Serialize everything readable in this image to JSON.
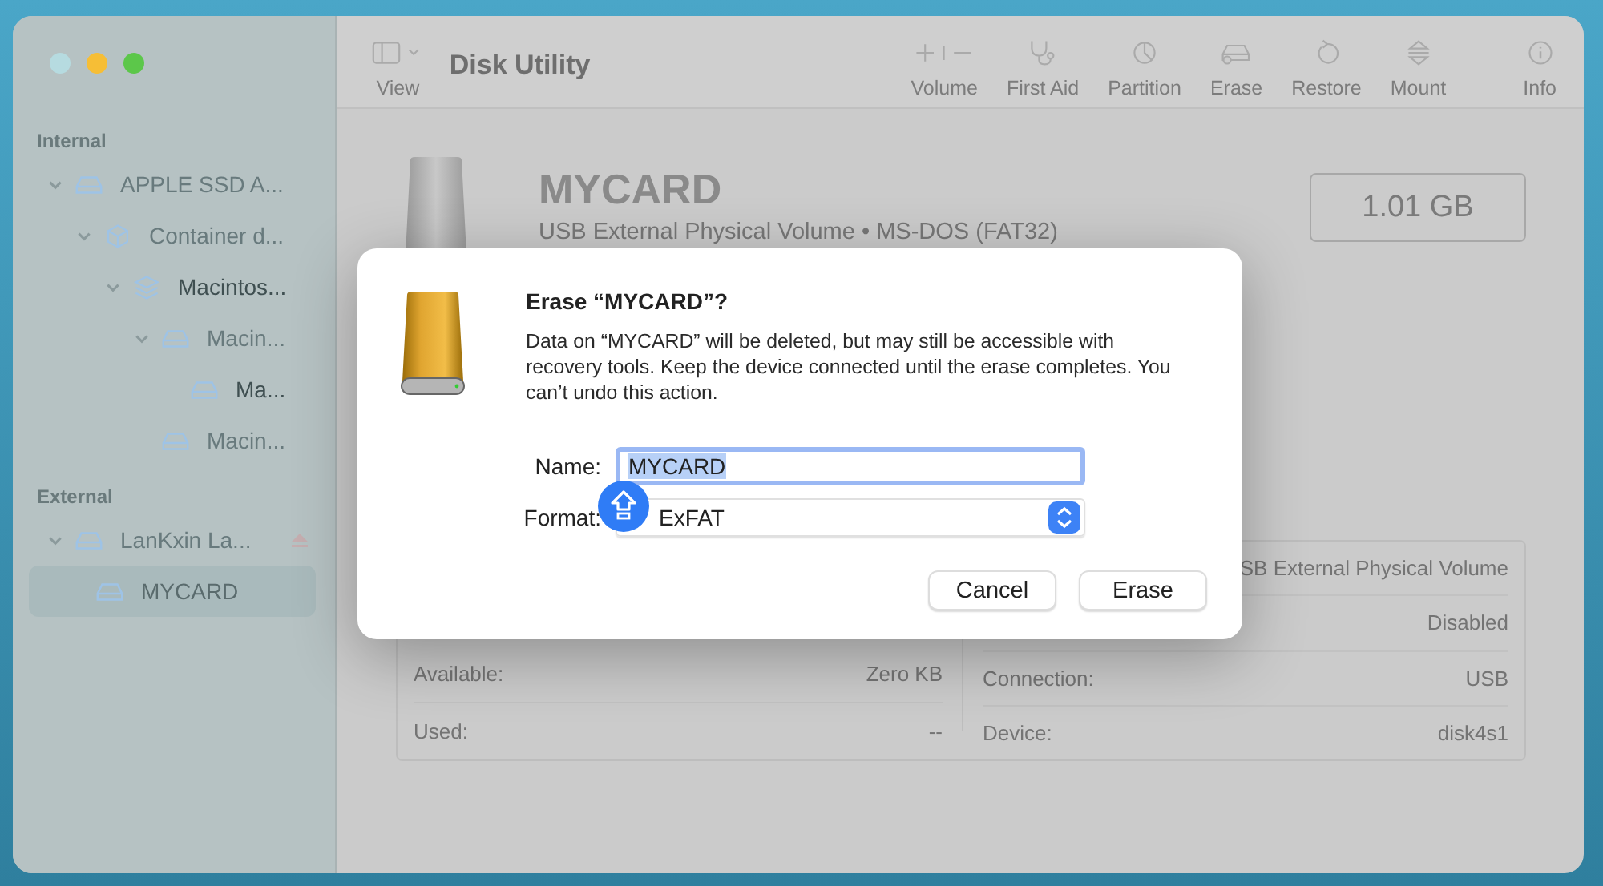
{
  "window": {
    "title": "Disk Utility"
  },
  "traffic_lights": [
    {
      "color": "#b6dbe0"
    },
    {
      "color": "#f6be36"
    },
    {
      "color": "#5cc74a"
    }
  ],
  "toolbar": {
    "view_label": "View",
    "items": [
      {
        "kind": "volume",
        "label": "Volume"
      },
      {
        "kind": "first-aid",
        "label": "First Aid"
      },
      {
        "kind": "partition",
        "label": "Partition"
      },
      {
        "kind": "erase",
        "label": "Erase"
      },
      {
        "kind": "restore",
        "label": "Restore"
      },
      {
        "kind": "mount",
        "label": "Mount"
      },
      {
        "kind": "info",
        "label": "Info"
      }
    ]
  },
  "sidebar": {
    "sections": [
      {
        "title": "Internal",
        "items": [
          {
            "kind": "drive",
            "label": "APPLE SSD A...",
            "mounted": false,
            "selected": false,
            "expanded": true,
            "children": [
              {
                "kind": "container",
                "label": "Container d...",
                "mounted": false,
                "selected": false,
                "expanded": true,
                "children": [
                  {
                    "kind": "layers",
                    "label": "Macintos...",
                    "mounted": true,
                    "selected": false,
                    "expanded": true,
                    "children": [
                      {
                        "kind": "drive",
                        "label": "Macin...",
                        "mounted": false,
                        "selected": false,
                        "expanded": true,
                        "children": [
                          {
                            "kind": "drive",
                            "label": "Ma...",
                            "mounted": true,
                            "selected": false
                          }
                        ]
                      },
                      {
                        "kind": "drive",
                        "label": "Macin...",
                        "mounted": false,
                        "selected": false
                      }
                    ]
                  }
                ]
              }
            ]
          }
        ]
      },
      {
        "title": "External",
        "items": [
          {
            "kind": "drive",
            "label": "LanKxin La...",
            "mounted": false,
            "selected": false,
            "expanded": true,
            "ejectable": true,
            "children": [
              {
                "kind": "drive",
                "label": "MYCARD",
                "mounted": false,
                "selected": true
              }
            ]
          }
        ]
      }
    ]
  },
  "device": {
    "name": "MYCARD",
    "subtitle": "USB External Physical Volume • MS-DOS (FAT32)",
    "size": "1.01 GB"
  },
  "info": {
    "left": [
      {
        "label": "Available:",
        "value": "Zero KB"
      },
      {
        "label": "Used:",
        "value": "--"
      }
    ],
    "right": [
      {
        "value": "SB External Physical Volume"
      },
      {
        "value": "Disabled"
      },
      {
        "label": "Connection:",
        "value": "USB"
      },
      {
        "label": "Device:",
        "value": "disk4s1"
      }
    ]
  },
  "dialog": {
    "title": "Erase “MYCARD”?",
    "message": "Data on “MYCARD” will be deleted, but may still be accessible with recovery tools. Keep the device connected until the erase completes. You can’t undo this action.",
    "name_label": "Name:",
    "name_value": "MYCARD",
    "name_selected": true,
    "format_label": "Format:",
    "format_value": "ExFAT",
    "caps_lock": true,
    "buttons": [
      {
        "label": "Cancel"
      },
      {
        "label": "Erase"
      }
    ]
  }
}
